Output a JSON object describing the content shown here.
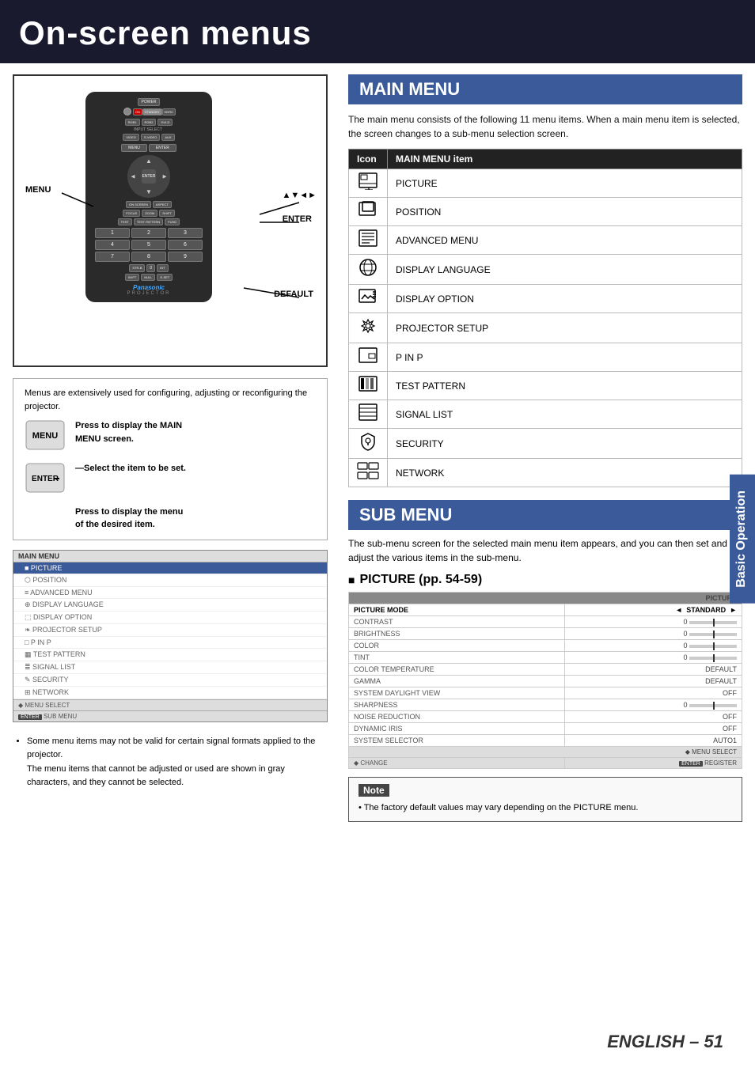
{
  "page": {
    "title": "On-screen menus",
    "number": "51",
    "language": "ENGLISH"
  },
  "header": {
    "title": "On-screen menus"
  },
  "remote": {
    "menu_label": "MENU",
    "enter_label": "ENTER",
    "arrows_label": "▲▼◄►",
    "default_label": "DEFAULT"
  },
  "menu_desc_box": {
    "intro": "Menus are extensively used for configuring, adjusting or reconfiguring the projector.",
    "items": [
      {
        "key": "MENU",
        "description": "Press to display the MAIN MENU screen."
      },
      {
        "key": "ENTER",
        "description": "Select the item to be set."
      },
      {
        "key": "",
        "description": "Press to display the menu of the desired item."
      }
    ]
  },
  "onscreen_menu": {
    "title": "MAIN MENU",
    "items": [
      {
        "label": "■ PICTURE",
        "active": true
      },
      {
        "label": "⬡ POSITION",
        "active": false
      },
      {
        "label": "≡ ADVANCED MENU",
        "active": false
      },
      {
        "label": "⊕ DISPLAY LANGUAGE",
        "active": false
      },
      {
        "label": "⬚ DISPLAY OPTION",
        "active": false
      },
      {
        "label": "❧ PROJECTOR SETUP",
        "active": false
      },
      {
        "label": "□ P IN P",
        "active": false
      },
      {
        "label": "▦ TEST PATTERN",
        "active": false
      },
      {
        "label": "≣ SIGNAL LIST",
        "active": false
      },
      {
        "label": "✎ SECURITY",
        "active": false
      },
      {
        "label": "⊞ NETWORK",
        "active": false
      }
    ],
    "footer1": "◆ MENU SELECT",
    "footer2": "ENTER SUB MENU"
  },
  "bottom_note": "Some menu items may not be valid for certain signal formats applied to the projector.\nThe menu items that cannot be adjusted or used are shown in gray characters, and they cannot be selected.",
  "main_menu_section": {
    "title": "MAIN MENU",
    "description": "The main menu consists of the following 11 menu items. When a main menu item is selected, the screen changes to a sub-menu selection screen.",
    "table_headers": [
      "Icon",
      "MAIN MENU item"
    ],
    "items": [
      {
        "icon": "🖼",
        "label": "PICTURE"
      },
      {
        "icon": "⬡",
        "label": "POSITION"
      },
      {
        "icon": "📋",
        "label": "ADVANCED MENU"
      },
      {
        "icon": "🌐",
        "label": "DISPLAY LANGUAGE"
      },
      {
        "icon": "🖥",
        "label": "DISPLAY OPTION"
      },
      {
        "icon": "⚙",
        "label": "PROJECTOR SETUP"
      },
      {
        "icon": "⧉",
        "label": "P IN P"
      },
      {
        "icon": "▦",
        "label": "TEST PATTERN"
      },
      {
        "icon": "≣",
        "label": "SIGNAL LIST"
      },
      {
        "icon": "🔒",
        "label": "SECURITY"
      },
      {
        "icon": "🖧",
        "label": "NETWORK"
      }
    ]
  },
  "sub_menu_section": {
    "title": "SUB MENU",
    "description": "The sub-menu screen for the selected main menu item appears, and you can then set and adjust the various items in the sub-menu."
  },
  "picture_section": {
    "title": "PICTURE (pp. 54-59)",
    "table_title": "PICTURE",
    "rows": [
      {
        "label": "PICTURE MODE",
        "value": "◄  STANDARD  ►",
        "type": "select"
      },
      {
        "label": "CONTRAST",
        "value": "0",
        "type": "slider"
      },
      {
        "label": "BRIGHTNESS",
        "value": "0",
        "type": "slider"
      },
      {
        "label": "COLOR",
        "value": "0",
        "type": "slider"
      },
      {
        "label": "TINT",
        "value": "0",
        "type": "slider"
      },
      {
        "label": "COLOR TEMPERATURE",
        "value": "DEFAULT",
        "type": "text"
      },
      {
        "label": "GAMMA",
        "value": "DEFAULT",
        "type": "text"
      },
      {
        "label": "SYSTEM DAYLIGHT VIEW",
        "value": "OFF",
        "type": "text"
      },
      {
        "label": "SHARPNESS",
        "value": "0",
        "type": "slider"
      },
      {
        "label": "NOISE REDUCTION",
        "value": "OFF",
        "type": "text"
      },
      {
        "label": "DYNAMIC IRIS",
        "value": "OFF",
        "type": "text"
      },
      {
        "label": "SYSTEM SELECTOR",
        "value": "AUTO1",
        "type": "text"
      }
    ],
    "footer1": "◆ MENU SELECT",
    "footer2": "◆ CHANGE",
    "footer3": "ENTER REGISTER"
  },
  "note_section": {
    "title": "Note",
    "text": "• The factory default values may vary depending on the PICTURE menu."
  },
  "side_tab": {
    "label": "Basic Operation"
  }
}
